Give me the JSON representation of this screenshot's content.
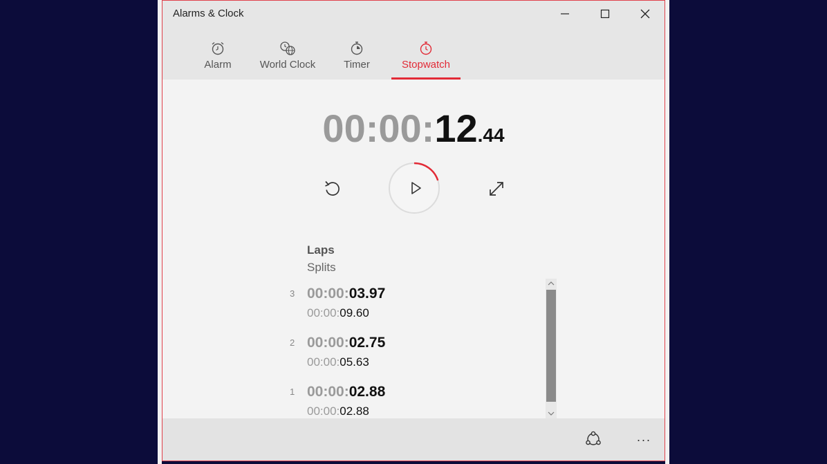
{
  "app": {
    "title": "Alarms & Clock"
  },
  "window_controls": {
    "minimize_icon": "minimize-icon",
    "maximize_icon": "maximize-icon",
    "close_icon": "close-icon"
  },
  "tabs": [
    {
      "label": "Alarm",
      "icon": "alarm-clock-icon",
      "active": false
    },
    {
      "label": "World Clock",
      "icon": "globe-clock-icon",
      "active": false
    },
    {
      "label": "Timer",
      "icon": "timer-icon",
      "active": false
    },
    {
      "label": "Stopwatch",
      "icon": "stopwatch-icon",
      "active": true
    }
  ],
  "stopwatch": {
    "hours": "00",
    "minutes": "00",
    "seconds": "12",
    "fraction": "44",
    "progress_fraction": 0.2
  },
  "controls": {
    "reset_icon": "reset-icon",
    "play_icon": "play-icon",
    "expand_icon": "expand-icon"
  },
  "laps_section": {
    "laps_label": "Laps",
    "splits_label": "Splits",
    "laps": [
      {
        "number": "3",
        "lap_dim": "00:00:",
        "lap_main": "03.97",
        "split_dim": "00:00:",
        "split_main": "09.60"
      },
      {
        "number": "2",
        "lap_dim": "00:00:",
        "lap_main": "02.75",
        "split_dim": "00:00:",
        "split_main": "05.63"
      },
      {
        "number": "1",
        "lap_dim": "00:00:",
        "lap_main": "02.88",
        "split_dim": "00:00:",
        "split_main": "02.88"
      }
    ]
  },
  "bottombar": {
    "share_icon": "share-icon",
    "more_label": "···"
  },
  "colors": {
    "accent": "#e22a36",
    "background": "#0c0c3a",
    "window_bg": "#f3f3f3",
    "bar_bg": "#e6e6e6"
  }
}
